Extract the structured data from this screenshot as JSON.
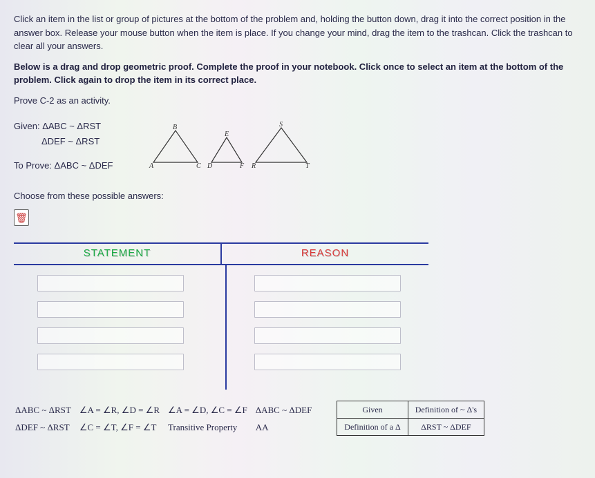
{
  "instructions": {
    "p1": "Click an item in the list or group of pictures at the bottom of the problem and, holding the button down, drag it into the correct position in the answer box. Release your mouse button when the item is place. If you change your mind, drag the item to the trashcan. Click the trashcan to clear all your answers.",
    "p2": "Below is a drag and drop geometric proof. Complete the proof in your notebook. Click once to select an item at the bottom of the problem. Click again to drop the item in its correct place.",
    "p3": "Prove C-2 as an activity."
  },
  "given": {
    "label": "Given:",
    "line1": "ΔABC ~ ΔRST",
    "line2": "ΔDEF ~ ΔRST",
    "toProveLabel": "To Prove:",
    "toProve": "ΔABC ~ ΔDEF"
  },
  "triangles": {
    "t1": {
      "top": "B",
      "bl": "A",
      "br": "C"
    },
    "t2": {
      "top": "E",
      "bl": "D",
      "br": "F"
    },
    "t3": {
      "top": "S",
      "bl": "R",
      "br": "T"
    }
  },
  "choose": "Choose from these possible answers:",
  "trashIcon": "🗑",
  "tableHead": {
    "stmt": "STATEMENT",
    "reas": "REASON"
  },
  "answers": {
    "col1r1": "ΔABC ~ ΔRST",
    "col1r2": "ΔDEF ~ ΔRST",
    "col2r1": "∠A = ∠R, ∠D = ∠R",
    "col2r2": "∠C = ∠T, ∠F = ∠T",
    "col3r1": "∠A = ∠D, ∠C = ∠F",
    "col3r2": "Transitive Property",
    "col4r1": "ΔABC ~ ΔDEF",
    "col4r2": "AA",
    "box": {
      "r1c1": "Given",
      "r1c2": "Definition of ~ Δ's",
      "r2c1": "Definition of a Δ",
      "r2c2": "ΔRST ~ ΔDEF"
    }
  }
}
